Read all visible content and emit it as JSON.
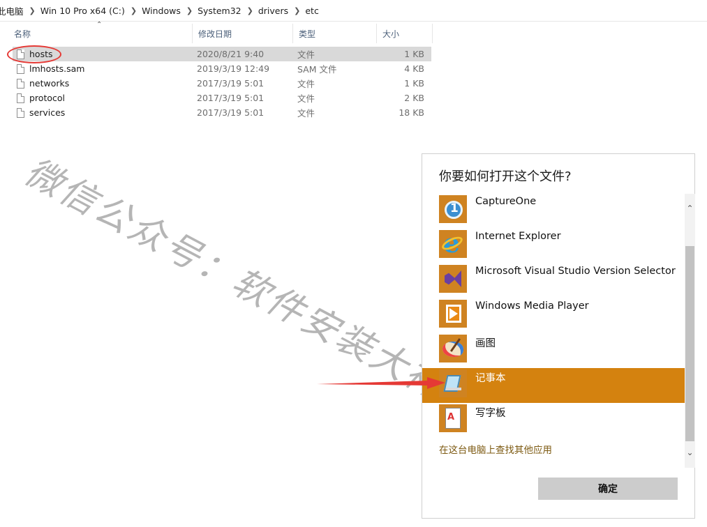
{
  "breadcrumb": [
    {
      "label": "此电脑"
    },
    {
      "label": "Win 10 Pro x64 (C:)"
    },
    {
      "label": "Windows"
    },
    {
      "label": "System32"
    },
    {
      "label": "drivers"
    },
    {
      "label": "etc"
    }
  ],
  "columns": {
    "name": "名称",
    "date": "修改日期",
    "type": "类型",
    "size": "大小"
  },
  "files": [
    {
      "name": "hosts",
      "date": "2020/8/21 9:40",
      "type": "文件",
      "size": "1 KB",
      "selected": true
    },
    {
      "name": "lmhosts.sam",
      "date": "2019/3/19 12:49",
      "type": "SAM 文件",
      "size": "4 KB"
    },
    {
      "name": "networks",
      "date": "2017/3/19 5:01",
      "type": "文件",
      "size": "1 KB"
    },
    {
      "name": "protocol",
      "date": "2017/3/19 5:01",
      "type": "文件",
      "size": "2 KB"
    },
    {
      "name": "services",
      "date": "2017/3/19 5:01",
      "type": "文件",
      "size": "18 KB"
    }
  ],
  "dialog": {
    "title": "你要如何打开这个文件?",
    "apps": [
      {
        "label": "CaptureOne",
        "icon": "captureone-icon"
      },
      {
        "label": "Internet Explorer",
        "icon": "internet-explorer-icon"
      },
      {
        "label": "Microsoft Visual Studio Version Selector",
        "icon": "visual-studio-icon"
      },
      {
        "label": "Windows Media Player",
        "icon": "media-player-icon"
      },
      {
        "label": "画图",
        "icon": "paint-icon"
      },
      {
        "label": "记事本",
        "icon": "notepad-icon",
        "selected": true
      },
      {
        "label": "写字板",
        "icon": "wordpad-icon"
      }
    ],
    "more_link": "在这台电脑上查找其他应用",
    "ok_label": "确定"
  },
  "watermark": "微信公众号：软件安装大神",
  "colors": {
    "selected_row": "#d9d9d9",
    "selected_app": "#d4820f",
    "app_tile": "#cf8321",
    "annotation": "#e53935",
    "link": "#7d5a12"
  }
}
